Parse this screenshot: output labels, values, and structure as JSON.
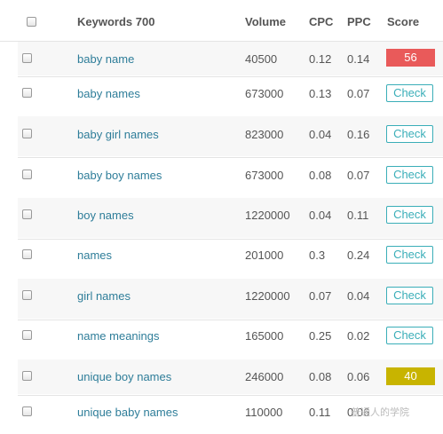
{
  "header": {
    "keywords_label": "Keywords 700",
    "volume_label": "Volume",
    "cpc_label": "CPC",
    "ppc_label": "PPC",
    "score_label": "Score"
  },
  "rows": [
    {
      "keyword": "baby name",
      "volume": "40500",
      "cpc": "0.12",
      "ppc": "0.14",
      "score": "56",
      "score_color": "#e95a5a"
    },
    {
      "keyword": "baby names",
      "volume": "673000",
      "cpc": "0.13",
      "ppc": "0.07",
      "action": "Check"
    },
    {
      "keyword": "baby girl names",
      "volume": "823000",
      "cpc": "0.04",
      "ppc": "0.16",
      "action": "Check"
    },
    {
      "keyword": "baby boy names",
      "volume": "673000",
      "cpc": "0.08",
      "ppc": "0.07",
      "action": "Check"
    },
    {
      "keyword": "boy names",
      "volume": "1220000",
      "cpc": "0.04",
      "ppc": "0.11",
      "action": "Check"
    },
    {
      "keyword": "names",
      "volume": "201000",
      "cpc": "0.3",
      "ppc": "0.24",
      "action": "Check"
    },
    {
      "keyword": "girl names",
      "volume": "1220000",
      "cpc": "0.07",
      "ppc": "0.04",
      "action": "Check"
    },
    {
      "keyword": "name meanings",
      "volume": "165000",
      "cpc": "0.25",
      "ppc": "0.02",
      "action": "Check"
    },
    {
      "keyword": "unique boy names",
      "volume": "246000",
      "cpc": "0.08",
      "ppc": "0.06",
      "score": "40",
      "score_color": "#c8b400"
    },
    {
      "keyword": "unique baby names",
      "volume": "110000",
      "cpc": "0.11",
      "ppc": "0.06"
    }
  ],
  "watermark": "普通人的学院",
  "colors": {
    "link": "#2e7d99",
    "check_accent": "#3aaeb8"
  }
}
